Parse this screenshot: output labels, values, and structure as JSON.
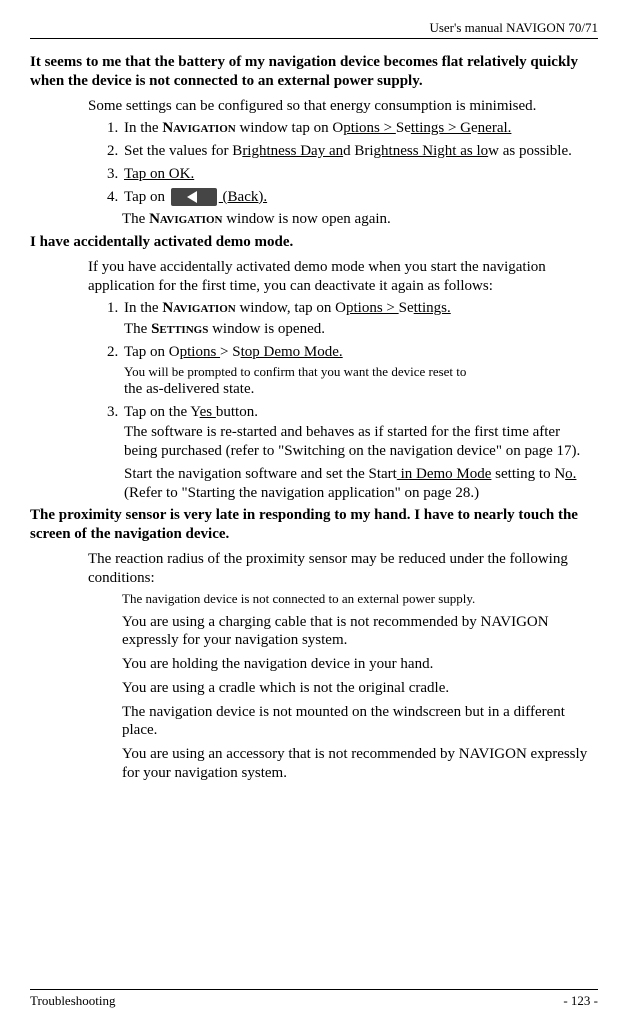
{
  "running_head": "User's manual NAVIGON 70/71",
  "faq1": {
    "heading": "It seems to me that the battery of my navigation device becomes flat relatively quickly when the device is not connected to an external power supply.",
    "intro": "Some settings can be configured so that energy consumption is minimised.",
    "step1_pre": "In the ",
    "step1_nav": "Navigation",
    "step1_mid": " window tap on O",
    "step1_u1": "ptions > ",
    "step1_mid2": "Se",
    "step1_u2": "ttings > G",
    "step1_mid3": "e",
    "step1_u3": "neral.",
    "step2_pre": "Set the values for B",
    "step2_u1": "rightness Day an",
    "step2_mid": "d Bri",
    "step2_u2": "ghtness Night as lo",
    "step2_post": "w as possible.",
    "step3": "Tap on OK.",
    "step4_pre": "Tap on ",
    "step4_post": " (Back).",
    "result_pre": "The ",
    "result_nav": "Navigation",
    "result_post": " window is now open again."
  },
  "faq2": {
    "heading": "I have accidentally activated demo mode.",
    "intro": "If you have accidentally activated demo mode when you start the navigation application for the first time, you can deactivate it again as follows:",
    "step1_pre": "In the ",
    "step1_nav": "Navigation",
    "step1_mid": " window, tap on O",
    "step1_u1": "ptions > ",
    "step1_mid2": "Se",
    "step1_u2": "ttings.",
    "step1_res_pre": "The ",
    "step1_res_sc": "Settings",
    "step1_res_post": " window is opened.",
    "step2_pre": "Tap on O",
    "step2_u1": "ptions ",
    "step2_mid": "> S",
    "step2_u2": "top Demo Mode.",
    "step2_note": "You will be prompted to confirm that you want the device reset to",
    "step2_note2": "the as-delivered state.",
    "step3_pre": "Tap on the Y",
    "step3_u1": "es ",
    "step3_post": "button.",
    "step3_res1": "The software is re-started and behaves as if started for the first time after being purchased (refer to \"Switching on the navigation device\" on page 17).",
    "step3_res2_pre": "Start the navigation software and set the Start",
    "step3_res2_u1": " in Demo Mode",
    "step3_res2_mid": " setting to N",
    "step3_res2_u2": "o. ",
    "step3_res2_post": "(Refer to \"Starting the navigation application\" on page 28.)"
  },
  "faq3": {
    "heading": "The proximity sensor is very late in responding to my hand. I have to nearly touch the screen of the navigation device.",
    "intro": "The reaction radius of the proximity sensor may be reduced under the following conditions:",
    "b1": "The navigation device is not connected to an external power supply.",
    "b2": "You are using a charging cable that is not recommended by NAVIGON expressly for your navigation system.",
    "b3": "You are holding the navigation device in your hand.",
    "b4": "You are using a cradle which is not the original cradle.",
    "b5": "The navigation device is not mounted on the windscreen but in a different place.",
    "b6": "You are using an accessory that is not recommended by NAVIGON expressly for your navigation system."
  },
  "footer": {
    "section": "Troubleshooting",
    "page": "- 123 -"
  }
}
